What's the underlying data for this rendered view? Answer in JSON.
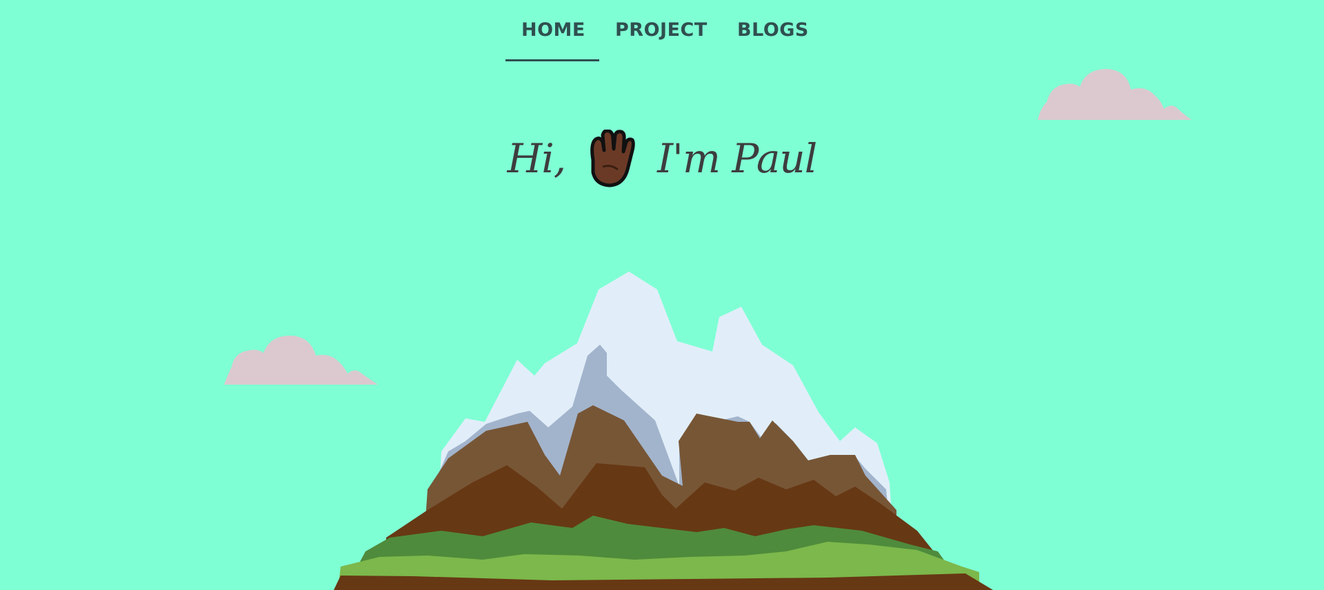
{
  "nav": {
    "items": [
      {
        "label": "HOME",
        "active": true
      },
      {
        "label": "PROJECT",
        "active": false
      },
      {
        "label": "BLOGS",
        "active": false
      }
    ]
  },
  "hero": {
    "greeting_prefix": "Hi,",
    "wave_icon": "waving-hand-icon",
    "greeting_name": "I'm Paul"
  },
  "colors": {
    "background": "#7fffd4",
    "nav_text": "#2f4f4f",
    "cloud": "#dbc9cf",
    "snow": "#e1eef9",
    "snow_shadow": "#a2b4cc",
    "rock_light": "#775636",
    "rock_dark": "#673814",
    "grass_dark": "#4f8b3c",
    "grass_light": "#7cb84b"
  }
}
